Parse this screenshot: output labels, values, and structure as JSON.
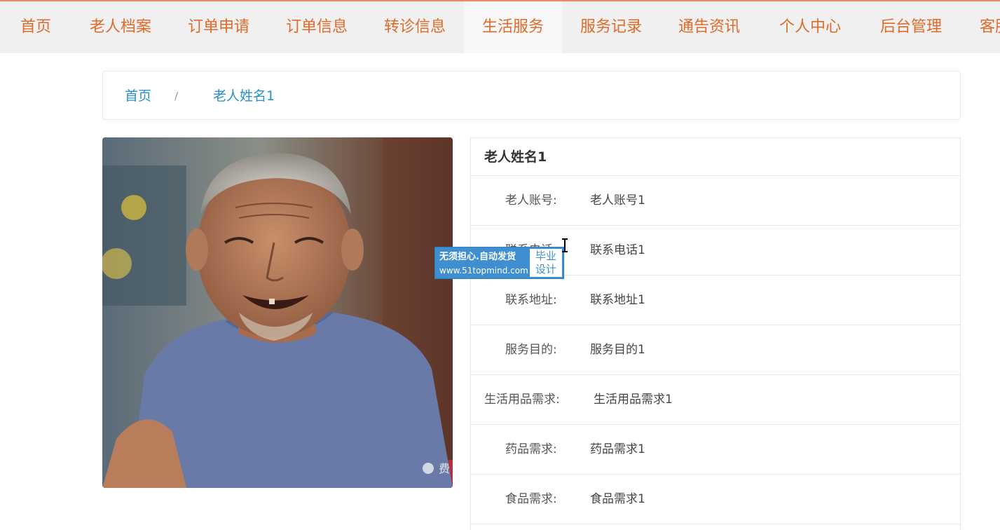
{
  "nav": {
    "items": [
      {
        "label": "首页"
      },
      {
        "label": "老人档案"
      },
      {
        "label": "订单申请"
      },
      {
        "label": "订单信息"
      },
      {
        "label": "转诊信息"
      },
      {
        "label": "生活服务",
        "active": true
      },
      {
        "label": "服务记录"
      },
      {
        "label": "通告资讯"
      },
      {
        "label": "个人中心"
      },
      {
        "label": "后台管理"
      },
      {
        "label": "客服"
      }
    ]
  },
  "breadcrumb": {
    "home": "首页",
    "separator": "/",
    "current": "老人姓名1"
  },
  "photo": {
    "alt": "老人照片",
    "corner_mark": "费"
  },
  "detail": {
    "title": "老人姓名1",
    "rows": [
      {
        "label": "老人账号:",
        "value": "老人账号1"
      },
      {
        "label": "联系电话:",
        "value": "联系电话1"
      },
      {
        "label": "联系地址:",
        "value": "联系地址1"
      },
      {
        "label": "服务目的:",
        "value": "服务目的1"
      },
      {
        "label": "生活用品需求:",
        "value": "生活用品需求1"
      },
      {
        "label": "药品需求:",
        "value": "药品需求1"
      },
      {
        "label": "食品需求:",
        "value": "食品需求1"
      }
    ]
  },
  "watermark": {
    "line1": "无须担心.自动发货",
    "line2": "www.51topmind.com",
    "badge_line1": "毕业",
    "badge_line2": "设计"
  },
  "colors": {
    "nav_text": "#e06a2a",
    "link": "#2a8fc6",
    "watermark": "#3f8fd0"
  }
}
